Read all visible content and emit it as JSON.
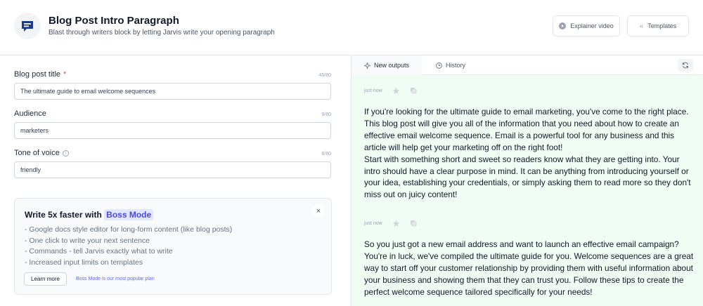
{
  "header": {
    "title": "Blog Post Intro Paragraph",
    "subtitle": "Blast through writers block by letting Jarvis write your opening paragraph",
    "explainer_label": "Explainer video",
    "templates_label": "Templates"
  },
  "form": {
    "title_label": "Blog post title",
    "title_required": "*",
    "title_counter": "45/80",
    "title_value": "The ultimate guide to email welcome sequences",
    "audience_label": "Audience",
    "audience_counter": "9/80",
    "audience_value": "marketers",
    "tone_label": "Tone of voice",
    "tone_counter": "8/80",
    "tone_value": "friendly"
  },
  "promo": {
    "title_prefix": "Write 5x faster with",
    "title_badge": "Boss Mode",
    "items": [
      "- Google docs style editor for long-form content (like blog posts)",
      "- One click to write your next sentence",
      "- Commands - tell Jarvis exactly what to write",
      "- Increased input limits on templates"
    ],
    "close": "×",
    "learn_more": "Learn more",
    "note": "Boss Mode is our most popular plan"
  },
  "outputs_panel": {
    "tab_new": "New outputs",
    "tab_history": "History",
    "outputs": [
      {
        "time": "just now",
        "text": "If you're looking for the ultimate guide to email marketing, you've come to the right place. This blog post will give you all of the information that you need about how to create an effective email welcome sequence. Email is a powerful tool for any business and this article will help get your marketing off on the right foot!\nStart with something short and sweet so readers know what they are getting into. Your intro should have a clear purpose in mind. It can be anything from introducing yourself or your idea, establishing your credentials, or simply asking them to read more so they don't miss out on juicy content!"
      },
      {
        "time": "just now",
        "text": "So you just got a new email address and want to launch an effective email campaign? You're in luck, we've compiled the ultimate guide for you. Welcome sequences are a great way to start off your customer relationship by providing them with useful information about your business and showing them that they can trust you. Follow these tips to create the perfect welcome sequence tailored specifically for your needs!"
      }
    ]
  },
  "colors": {
    "accent": "#4f46e5",
    "output_bg": "#f0fdf4",
    "required": "#ef4444"
  },
  "icons": [
    "chat-bubble-icon",
    "play-icon",
    "chevrons-left-icon",
    "info-icon",
    "sparkle-icon",
    "clock-icon",
    "refresh-icon",
    "star-icon",
    "copy-icon",
    "close-icon"
  ]
}
